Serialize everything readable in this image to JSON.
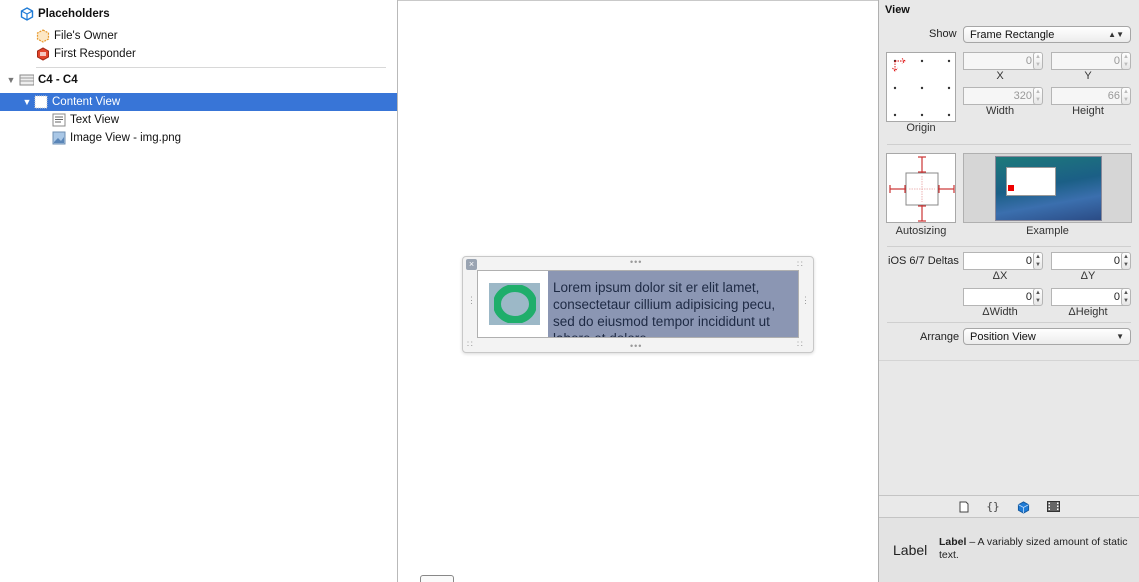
{
  "outline": {
    "placeholders": "Placeholders",
    "files_owner": "File's Owner",
    "first_responder": "First Responder",
    "root": "C4 - C4",
    "content_view": "Content View",
    "text_view": "Text View",
    "image_view": "Image View - img.png"
  },
  "canvas": {
    "lorem": "Lorem ipsum dolor sit er elit lamet, consectetaur cillium adipisicing pecu, sed do eiusmod tempor incididunt ut labore et dolore"
  },
  "inspector": {
    "section_title": "View",
    "show_label": "Show",
    "show_value": "Frame Rectangle",
    "x_value": "0",
    "y_value": "0",
    "x_label": "X",
    "y_label": "Y",
    "width_value": "320",
    "height_value": "66",
    "width_label": "Width",
    "height_label": "Height",
    "origin_label": "Origin",
    "autosizing_label": "Autosizing",
    "example_label": "Example",
    "deltas_label": "iOS 6/7 Deltas",
    "dx_value": "0",
    "dy_value": "0",
    "dx_label": "ΔX",
    "dy_label": "ΔY",
    "dwidth_value": "0",
    "dheight_value": "0",
    "dwidth_label": "ΔWidth",
    "dheight_label": "ΔHeight",
    "arrange_label": "Arrange",
    "arrange_value": "Position View"
  },
  "library": {
    "icon_text": "Label",
    "title": "Label",
    "description": " – A variably sized amount of static text."
  }
}
